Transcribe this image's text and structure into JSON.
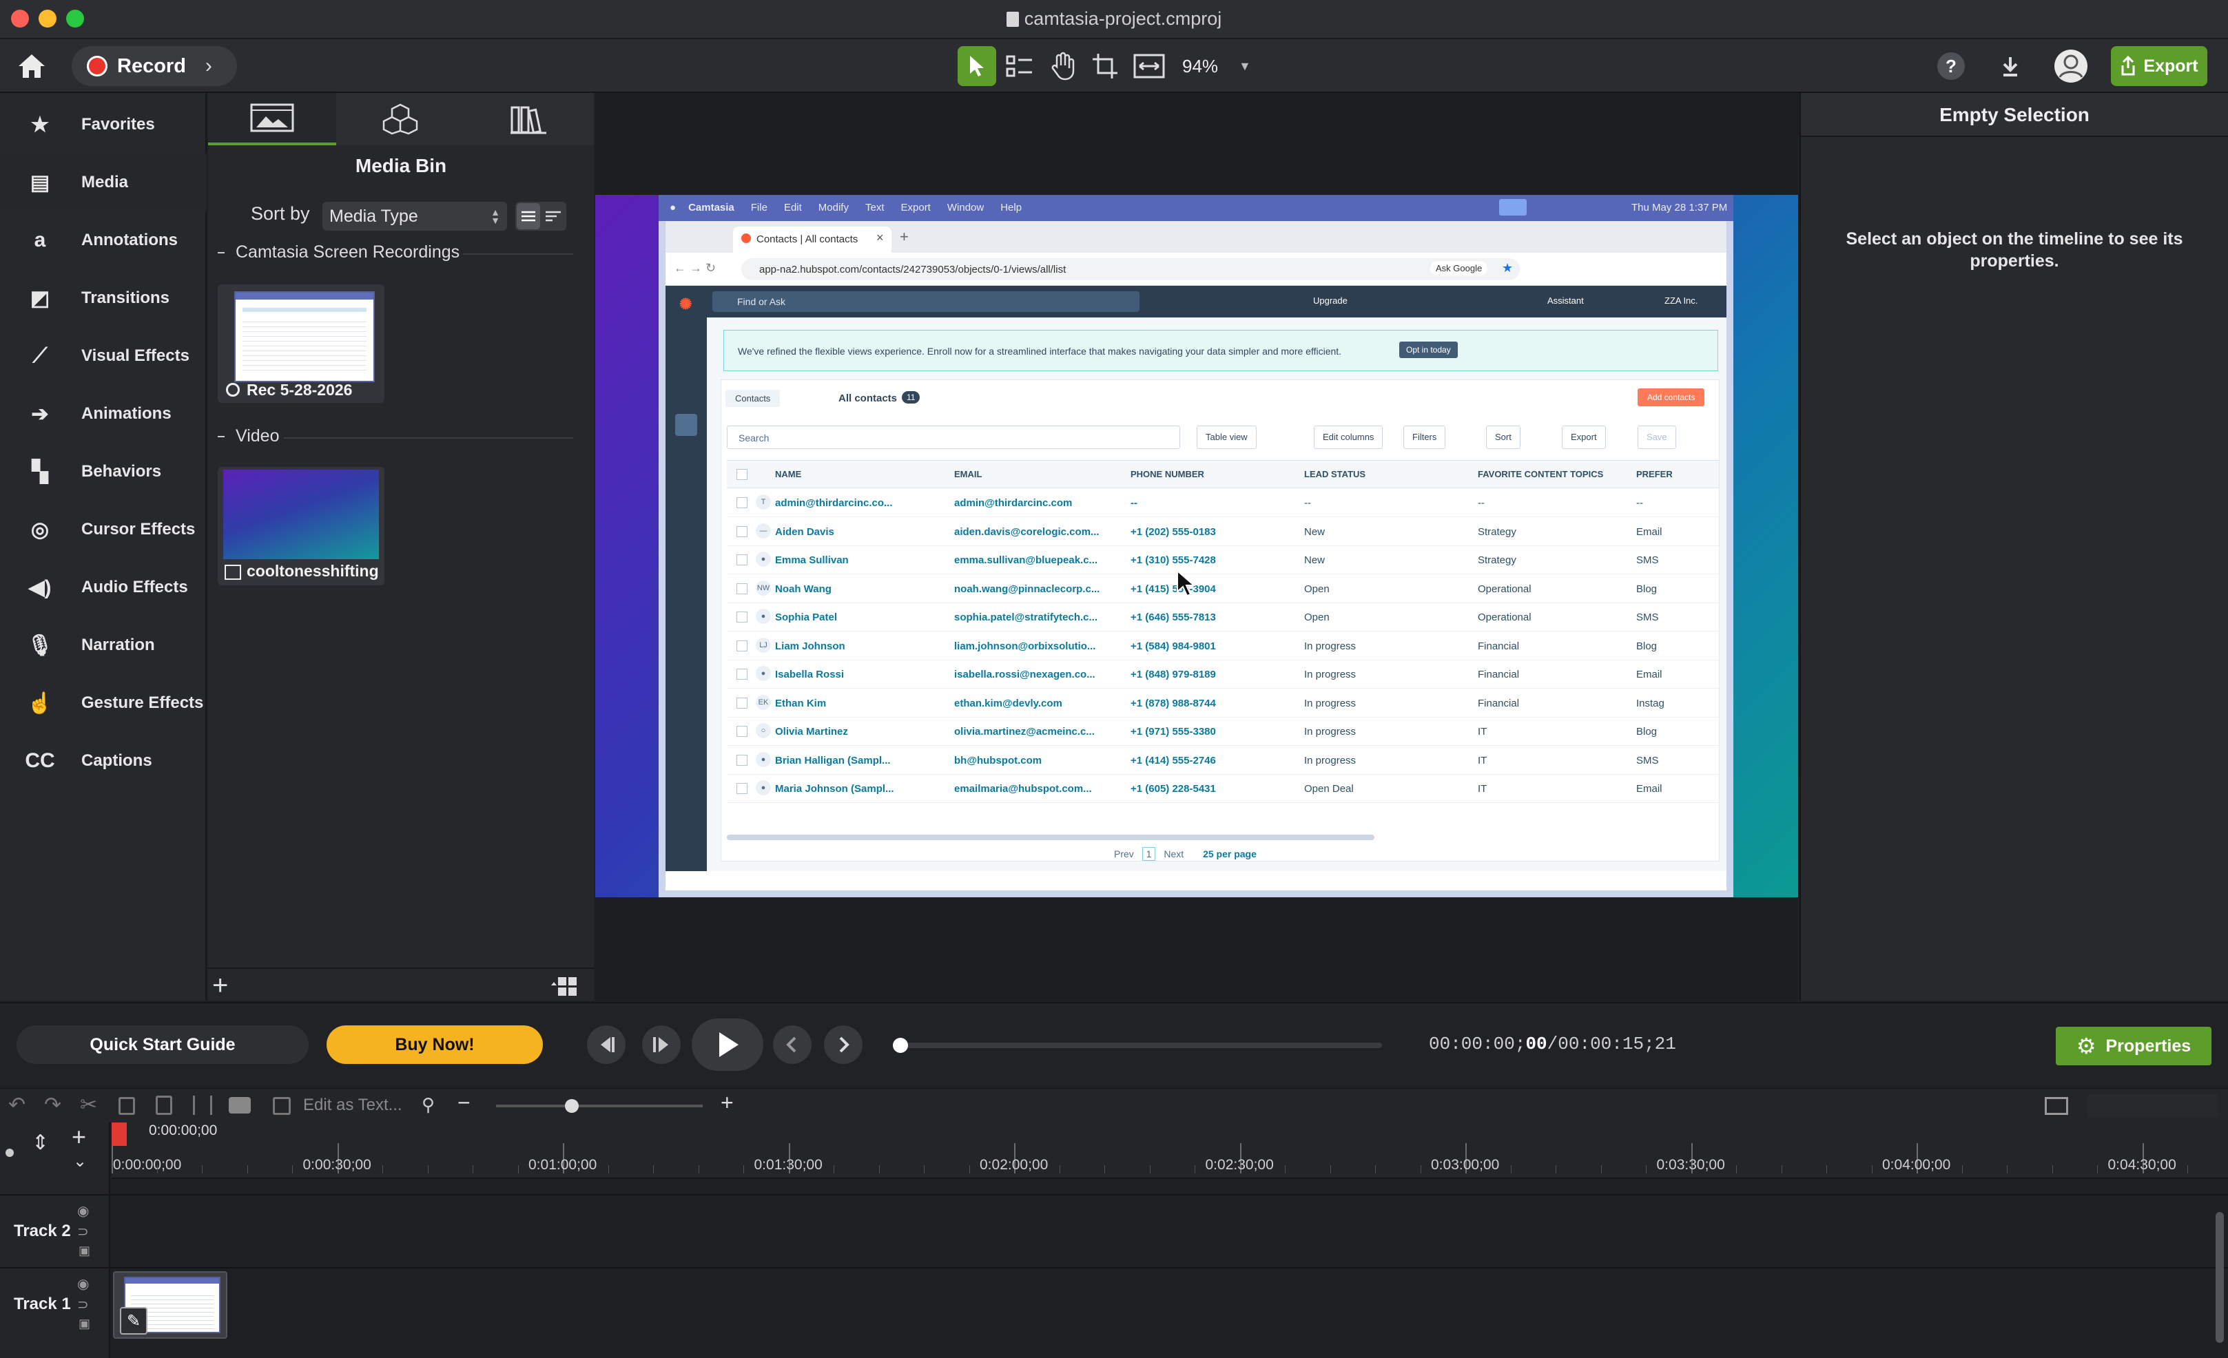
{
  "window": {
    "title": "camtasia-project.cmproj"
  },
  "toolbar": {
    "record_label": "Record",
    "zoom": "94%",
    "export_label": "Export"
  },
  "nav": {
    "items": [
      {
        "label": "Favorites",
        "icon": "star-icon"
      },
      {
        "label": "Media",
        "icon": "film-icon"
      },
      {
        "label": "Annotations",
        "icon": "annotation-icon"
      },
      {
        "label": "Transitions",
        "icon": "transition-icon"
      },
      {
        "label": "Visual Effects",
        "icon": "magic-wand-icon"
      },
      {
        "label": "Animations",
        "icon": "arrow-right-icon"
      },
      {
        "label": "Behaviors",
        "icon": "behaviors-icon"
      },
      {
        "label": "Cursor Effects",
        "icon": "cursor-icon"
      },
      {
        "label": "Audio Effects",
        "icon": "speaker-icon"
      },
      {
        "label": "Narration",
        "icon": "microphone-icon"
      },
      {
        "label": "Gesture Effects",
        "icon": "hand-icon"
      },
      {
        "label": "Captions",
        "icon": "captions-icon"
      }
    ]
  },
  "mediabin": {
    "title": "Media Bin",
    "sort_label": "Sort by",
    "sort_value": "Media Type",
    "group1": "Camtasia Screen Recordings",
    "item1": "Rec 5-28-2026",
    "group2": "Video",
    "item2": "cooltonesshifting"
  },
  "props": {
    "title": "Empty Selection",
    "hint": "Select an object on the timeline to see its properties."
  },
  "controls": {
    "quickstart": "Quick Start Guide",
    "buynow": "Buy Now!",
    "time_current": "00:00:00;",
    "time_frames": "00",
    "time_total": "/00:00:15;21",
    "properties_label": "Properties"
  },
  "tltools": {
    "edit_as_text": "Edit as Text..."
  },
  "timeline": {
    "playhead": "0:00:00;00",
    "ruler": [
      "0:00:00;00",
      "0:00:30;00",
      "0:01:00;00",
      "0:01:30;00",
      "0:02:00;00",
      "0:02:30;00",
      "0:03:00;00",
      "0:03:30;00",
      "0:04:00;00",
      "0:04:30;00"
    ],
    "tracks": [
      "Track 2",
      "Track 1"
    ]
  },
  "recording": {
    "menubar": [
      "Camtasia",
      "File",
      "Edit",
      "Modify",
      "Text",
      "Export",
      "Window",
      "Help"
    ],
    "clock": "Thu May 28  1:37 PM",
    "tab_title": "Contacts | All contacts",
    "url": "app-na2.hubspot.com/contacts/242739053/objects/0-1/views/all/list",
    "ask_google": "Ask Google",
    "search_placeholder": "Find or Ask",
    "upgrade": "Upgrade",
    "assistant": "Assistant",
    "account": "ZZA Inc.",
    "banner": "We've refined the flexible views experience. Enroll now for a streamlined interface that makes navigating your data simpler and more efficient.",
    "banner_button": "Opt in today",
    "contacts_dropdown": "Contacts",
    "all_contacts": "All contacts",
    "all_contacts_count": "11",
    "add_contacts": "Add contacts",
    "search": "Search",
    "tools": [
      "Table view",
      "Edit columns",
      "Filters",
      "Sort",
      "Export",
      "Save"
    ],
    "columns": [
      "NAME",
      "EMAIL",
      "PHONE NUMBER",
      "LEAD STATUS",
      "FAVORITE CONTENT TOPICS",
      "PREFER"
    ],
    "rows": [
      {
        "avatar": "T",
        "name": "admin@thirdarcinc.co...",
        "email": "admin@thirdarcinc.com",
        "phone": "--",
        "status": "--",
        "topic": "--",
        "pref": "--"
      },
      {
        "avatar": "—",
        "name": "Aiden Davis",
        "email": "aiden.davis@corelogic.com...",
        "phone": "+1 (202) 555-0183",
        "status": "New",
        "topic": "Strategy",
        "pref": "Email"
      },
      {
        "avatar": "●",
        "name": "Emma Sullivan",
        "email": "emma.sullivan@bluepeak.c...",
        "phone": "+1 (310) 555-7428",
        "status": "New",
        "topic": "Strategy",
        "pref": "SMS"
      },
      {
        "avatar": "NW",
        "name": "Noah Wang",
        "email": "noah.wang@pinnaclecorp.c...",
        "phone": "+1 (415) 555-3904",
        "status": "Open",
        "topic": "Operational",
        "pref": "Blog"
      },
      {
        "avatar": "●",
        "name": "Sophia Patel",
        "email": "sophia.patel@stratifytech.c...",
        "phone": "+1 (646) 555-7813",
        "status": "Open",
        "topic": "Operational",
        "pref": "SMS"
      },
      {
        "avatar": "LJ",
        "name": "Liam Johnson",
        "email": "liam.johnson@orbixsolutio...",
        "phone": "+1 (584) 984-9801",
        "status": "In progress",
        "topic": "Financial",
        "pref": "Blog"
      },
      {
        "avatar": "●",
        "name": "Isabella Rossi",
        "email": "isabella.rossi@nexagen.co...",
        "phone": "+1 (848) 979-8189",
        "status": "In progress",
        "topic": "Financial",
        "pref": "Email"
      },
      {
        "avatar": "EK",
        "name": "Ethan Kim",
        "email": "ethan.kim@devly.com",
        "phone": "+1 (878) 988-8744",
        "status": "In progress",
        "topic": "Financial",
        "pref": "Instag"
      },
      {
        "avatar": "○",
        "name": "Olivia Martinez",
        "email": "olivia.martinez@acmeinc.c...",
        "phone": "+1 (971) 555-3380",
        "status": "In progress",
        "topic": "IT",
        "pref": "Blog"
      },
      {
        "avatar": "●",
        "name": "Brian Halligan (Sampl...",
        "email": "bh@hubspot.com",
        "phone": "+1 (414) 555-2746",
        "status": "In progress",
        "topic": "IT",
        "pref": "SMS"
      },
      {
        "avatar": "●",
        "name": "Maria Johnson (Sampl...",
        "email": "emailmaria@hubspot.com...",
        "phone": "+1 (605) 228-5431",
        "status": "Open Deal",
        "topic": "IT",
        "pref": "Email"
      }
    ],
    "pager": {
      "prev": "Prev",
      "page": "1",
      "next": "Next",
      "per_page": "25 per page"
    }
  },
  "colors": {
    "accent_green": "#5d9e2a",
    "buy_yellow": "#f5b221",
    "record_red": "#e8322c",
    "hubspot_orange": "#ff5c35"
  }
}
